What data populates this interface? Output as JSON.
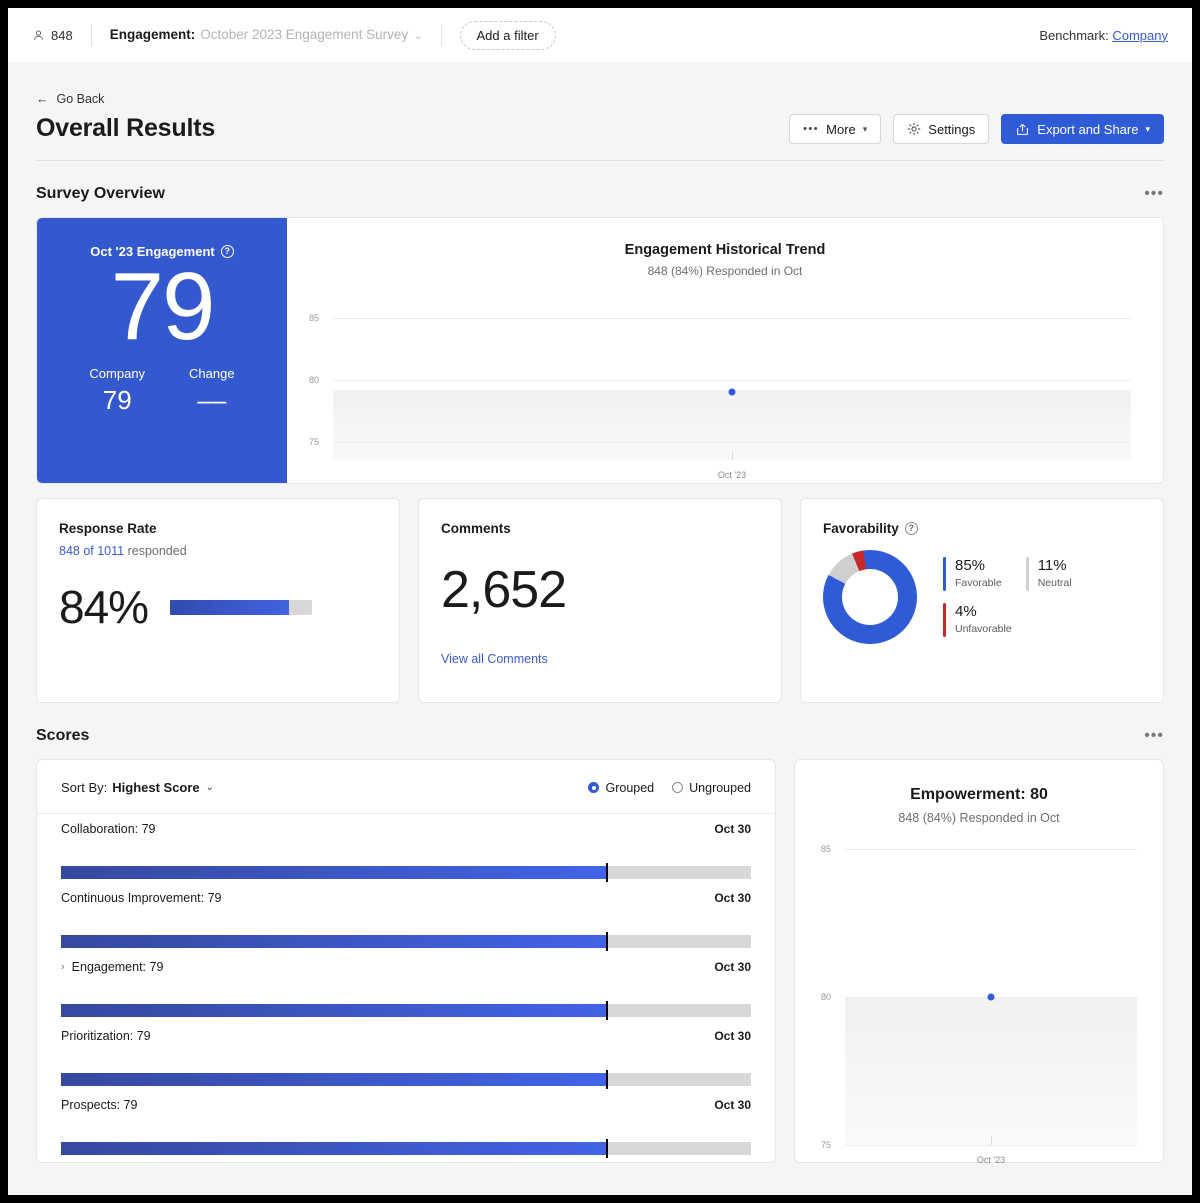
{
  "topbar": {
    "respondent_icon": "person-icon",
    "respondent_count": "848",
    "engagement_label": "Engagement:",
    "engagement_value": "October 2023 Engagement Survey",
    "chevron": "⌄",
    "add_filter": "Add a filter",
    "benchmark_label": "Benchmark:",
    "benchmark_value": "Company"
  },
  "header": {
    "back_arrow": "←",
    "back_label": "Go Back",
    "title": "Overall Results",
    "more_label": "More",
    "settings_label": "Settings",
    "export_label": "Export and Share",
    "dots": "•••"
  },
  "survey_overview": {
    "section_title": "Survey Overview",
    "menu_dots": "•••",
    "engagement_card": {
      "title": "Oct '23 Engagement",
      "help": "?",
      "score": "79",
      "company_label": "Company",
      "company_value": "79",
      "change_label": "Change",
      "change_value": "––"
    }
  },
  "cards": {
    "response_rate": {
      "title": "Response Rate",
      "responded_count": "848 of 1011",
      "responded_suffix": " responded",
      "percent": "84%",
      "fill_pct": 84
    },
    "comments": {
      "title": "Comments",
      "count": "2,652",
      "link": "View all Comments"
    },
    "favorability": {
      "title": "Favorability",
      "help": "?",
      "items": [
        {
          "pct": "85%",
          "label": "Favorable",
          "color": "#2f5bd7",
          "value": 85
        },
        {
          "pct": "11%",
          "label": "Neutral",
          "color": "#cfcfcf",
          "value": 11
        },
        {
          "pct": "4%",
          "label": "Unfavorable",
          "color": "#c62828",
          "value": 4
        }
      ]
    }
  },
  "scores": {
    "section_title": "Scores",
    "menu_dots": "•••",
    "sort_label": "Sort By:",
    "sort_value": "Highest Score",
    "sort_chevron": "⌄",
    "grouped_label": "Grouped",
    "ungrouped_label": "Ungrouped",
    "grouped_selected": true,
    "items": [
      {
        "label": "Collaboration: 79",
        "date": "Oct 30",
        "value": 79,
        "expandable": false
      },
      {
        "label": "Continuous Improvement: 79",
        "date": "Oct 30",
        "value": 79,
        "expandable": false
      },
      {
        "label": "Engagement: 79",
        "date": "Oct 30",
        "value": 79,
        "expandable": true,
        "chevron": "›"
      },
      {
        "label": "Prioritization: 79",
        "date": "Oct 30",
        "value": 79,
        "expandable": false
      },
      {
        "label": "Prospects: 79",
        "date": "Oct 30",
        "value": 79,
        "expandable": false
      }
    ]
  },
  "chart_data": [
    {
      "type": "line",
      "id": "engagement-historical-trend",
      "title": "Engagement Historical Trend",
      "subtitle": "848 (84%) Responded in Oct",
      "x": [
        "Oct '23"
      ],
      "values": [
        79
      ],
      "categories": [
        "Oct '23"
      ],
      "series": [
        {
          "name": "Engagement",
          "values": [
            79
          ]
        }
      ],
      "ylim": [
        73.5,
        86.5
      ],
      "yticks": [
        75,
        80,
        85
      ],
      "ytick_labels": [
        "75",
        "80",
        "85"
      ],
      "xlabel": "",
      "ylabel": "",
      "grid": true,
      "legend": "none",
      "band": {
        "label": "benchmark range",
        "from": 73.5,
        "to": 79.2,
        "color": "#f1f1f1"
      },
      "point_color": "#2f5bd7"
    },
    {
      "type": "line",
      "id": "empowerment-trend",
      "title": "Empowerment: 80",
      "subtitle": "848 (84%) Responded in Oct",
      "x": [
        "Oct '23"
      ],
      "values": [
        80
      ],
      "categories": [
        "Oct '23"
      ],
      "series": [
        {
          "name": "Empowerment",
          "values": [
            80
          ]
        }
      ],
      "ylim": [
        75,
        85
      ],
      "yticks": [
        75,
        80,
        85
      ],
      "ytick_labels": [
        "75",
        "80",
        "85"
      ],
      "xlabel": "",
      "ylabel": "",
      "grid": true,
      "legend": "none",
      "band": {
        "label": "benchmark range",
        "from": 75,
        "to": 80,
        "color": "#f1f1f1"
      },
      "point_color": "#2f5bd7"
    },
    {
      "type": "pie",
      "id": "favorability-donut",
      "title": "Favorability",
      "labels": [
        "Favorable",
        "Neutral",
        "Unfavorable"
      ],
      "values": [
        85,
        11,
        4
      ],
      "colors": [
        "#2f5bd7",
        "#cfcfcf",
        "#c62828"
      ],
      "legend": "right"
    },
    {
      "type": "bar",
      "id": "scores-bars",
      "title": "Scores",
      "categories": [
        "Collaboration",
        "Continuous Improvement",
        "Engagement",
        "Prioritization",
        "Prospects"
      ],
      "values": [
        79,
        79,
        79,
        79,
        79
      ],
      "benchmarks": [
        79,
        79,
        79,
        79,
        79
      ],
      "xlim": [
        0,
        100
      ],
      "xlabel": "",
      "ylabel": "",
      "grid": false,
      "legend": "none"
    }
  ]
}
